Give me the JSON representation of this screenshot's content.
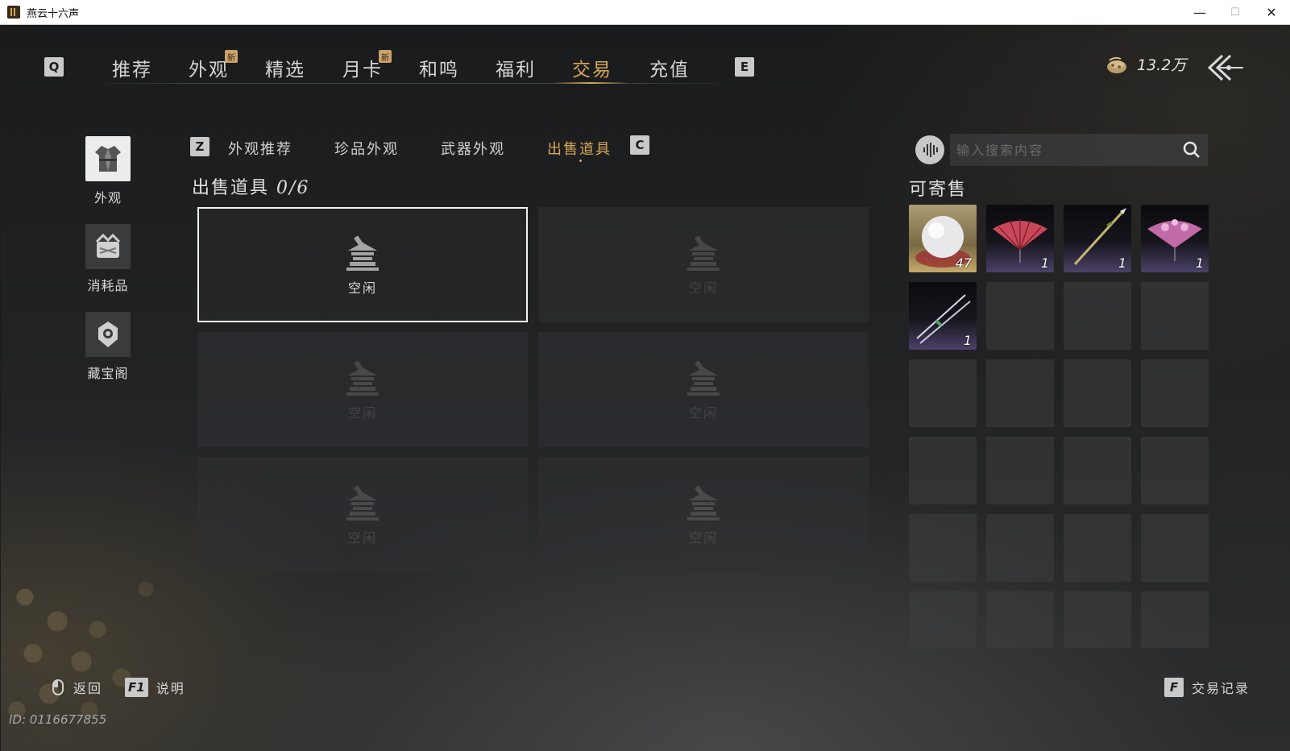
{
  "window": {
    "title": "燕云十六声",
    "minimize": "—",
    "maximize": "☐",
    "close": "✕"
  },
  "topnav": {
    "prev_key": "Q",
    "next_key": "E",
    "tabs": [
      {
        "label": "推荐",
        "new": false
      },
      {
        "label": "外观",
        "new": true
      },
      {
        "label": "精选",
        "new": false
      },
      {
        "label": "月卡",
        "new": true
      },
      {
        "label": "和鸣",
        "new": false
      },
      {
        "label": "福利",
        "new": false
      },
      {
        "label": "交易",
        "new": false,
        "active": true
      },
      {
        "label": "充值",
        "new": false
      }
    ],
    "new_badge": "新",
    "currency_value": "13.2万",
    "accent_color": "#d8a85a"
  },
  "sidebar": {
    "items": [
      {
        "label": "外观",
        "icon": "robe-icon",
        "active": true
      },
      {
        "label": "消耗品",
        "icon": "bundle-icon",
        "active": false
      },
      {
        "label": "藏宝阁",
        "icon": "treasure-icon",
        "active": false
      }
    ]
  },
  "subtabs": {
    "prev_key": "Z",
    "next_key": "C",
    "items": [
      "外观推荐",
      "珍品外观",
      "武器外观",
      "出售道具"
    ],
    "active_index": 3
  },
  "sell": {
    "title": "出售道具",
    "count": "0/6",
    "slot_label": "空闲",
    "slots": 6,
    "selected_index": 0
  },
  "inventory": {
    "search_placeholder": "输入搜索内容",
    "title": "可寄售",
    "items": [
      {
        "icon": "pearl-icon",
        "qty": "47"
      },
      {
        "icon": "red-fan-icon",
        "qty": "1"
      },
      {
        "icon": "spear-icon",
        "qty": "1"
      },
      {
        "icon": "pink-fan-icon",
        "qty": "1"
      },
      {
        "icon": "twin-blades-icon",
        "qty": "1"
      }
    ],
    "total_cells": 24
  },
  "footer": {
    "back_label": "返回",
    "help_key": "F1",
    "help_label": "说明",
    "history_key": "F",
    "history_label": "交易记录",
    "uid": "ID: 0116677855"
  }
}
